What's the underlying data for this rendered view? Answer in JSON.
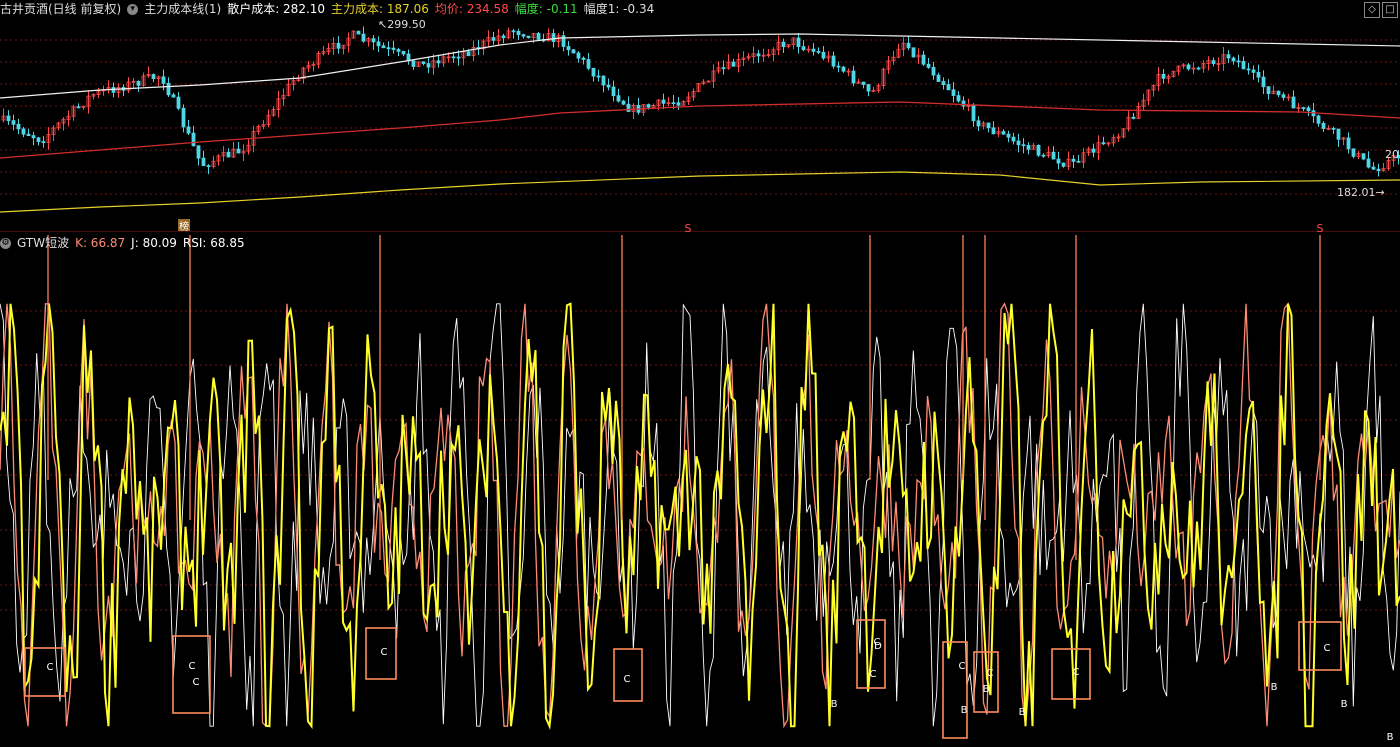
{
  "price_panel": {
    "title": "古井贡酒(日线 前复权)",
    "indicator_name": "主力成本线(1)",
    "retail_cost_label": "散户成本: 282.10",
    "main_cost_label": "主力成本: 187.06",
    "avg_label": "均价: 234.58",
    "amp_label": "幅度: -0.11",
    "amp1_label": "幅度1: -0.34",
    "high_label": "299.50",
    "low_label": "182.01",
    "right_edge_label": "20",
    "markers": [
      "榜",
      "S",
      "S"
    ]
  },
  "osc_panel": {
    "title": "GTW短波",
    "k_label": "K: 66.87",
    "j_label": "J: 80.09",
    "rsi_label": "RSI: 68.85",
    "signal_c": "C",
    "signal_b": "B",
    "signal_d": "D"
  },
  "colors": {
    "bg": "#000000",
    "grid": "#6b1414",
    "up": "#ff4a4a",
    "down": "#4fd6e6",
    "white_line": "#f0f0f0",
    "red_line": "#d22d2d",
    "yellow_line": "#e6d12a",
    "osc_yellow": "#ffff2a",
    "osc_pink": "#ff8c74",
    "osc_white": "#ffffff",
    "box": "#ff8c5a",
    "arrow": "#ff7f50"
  },
  "chart_data": {
    "type": "line",
    "title": "古井贡酒(日线 前复权)",
    "series": [
      {
        "name": "散户成本",
        "values": [
          282.1
        ]
      },
      {
        "name": "主力成本",
        "values": [
          187.06
        ]
      },
      {
        "name": "均价",
        "values": [
          234.58
        ]
      }
    ],
    "annotations": [
      "299.50",
      "182.01"
    ]
  }
}
